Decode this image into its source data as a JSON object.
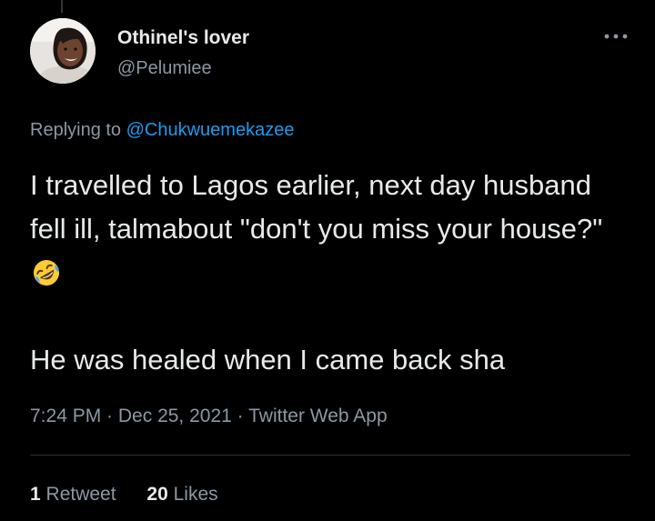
{
  "author": {
    "display_name": "Othinel's lover",
    "handle": "@Pelumiee",
    "avatar": "profile-photo"
  },
  "reply": {
    "prefix": "Replying to ",
    "mention": "@Chukwuemekazee"
  },
  "tweet": {
    "paragraph_1": "I travelled to Lagos earlier, next day husband fell ill, talmabout \"don't you miss your house?\"",
    "paragraph_1_emoji": "rolling-on-the-floor-laughing-emoji",
    "paragraph_2": "He was healed when I came back sha"
  },
  "meta": {
    "time": "7:24 PM",
    "separator": " · ",
    "date": "Dec 25, 2021",
    "app": "Twitter Web App"
  },
  "stats": {
    "retweets_count": "1",
    "retweets_label": " Retweet",
    "likes_count": "20",
    "likes_label": " Likes"
  },
  "icons": {
    "more": "more-horizontal-icon"
  },
  "colors": {
    "background": "#000000",
    "text_primary": "#e7e9ea",
    "text_secondary": "#8b98a5",
    "accent": "#1d9bf0",
    "divider": "#2f3336"
  }
}
